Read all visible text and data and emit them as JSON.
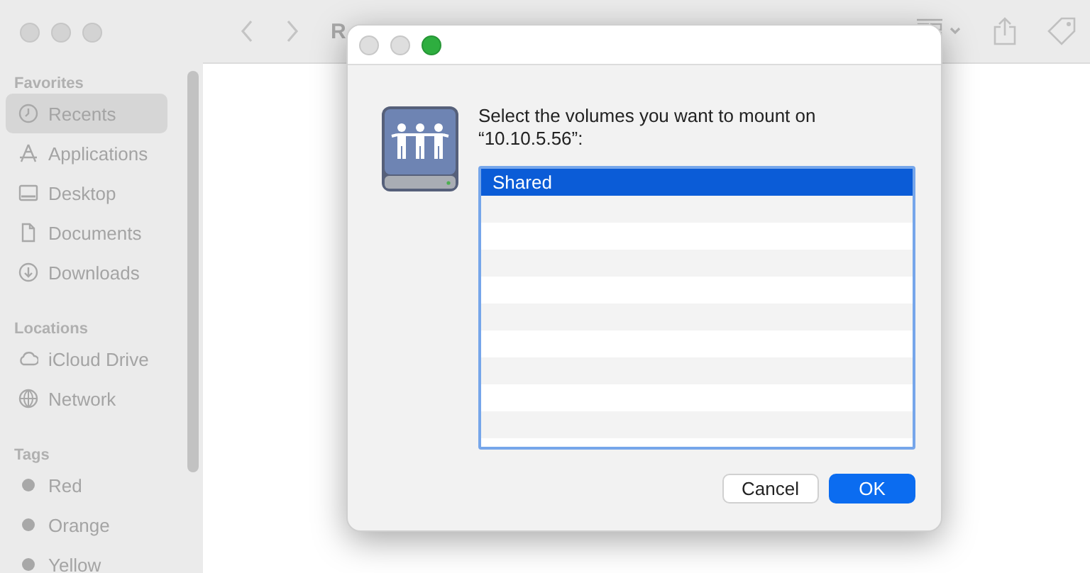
{
  "finder": {
    "title": "R",
    "sidebar": [
      {
        "heading": "Favorites",
        "items": [
          {
            "label": "Recents",
            "kind": "clock",
            "selected": true
          },
          {
            "label": "Applications",
            "kind": "apps",
            "selected": false
          },
          {
            "label": "Desktop",
            "kind": "desktop",
            "selected": false
          },
          {
            "label": "Documents",
            "kind": "document",
            "selected": false
          },
          {
            "label": "Downloads",
            "kind": "download",
            "selected": false
          }
        ]
      },
      {
        "heading": "Locations",
        "items": [
          {
            "label": "iCloud Drive",
            "kind": "cloud",
            "selected": false
          },
          {
            "label": "Network",
            "kind": "globe",
            "selected": false
          }
        ]
      },
      {
        "heading": "Tags",
        "items": [
          {
            "label": "Red",
            "kind": "tag",
            "selected": false
          },
          {
            "label": "Orange",
            "kind": "tag",
            "selected": false
          },
          {
            "label": "Yellow",
            "kind": "tag",
            "selected": false
          }
        ]
      }
    ]
  },
  "dialog": {
    "message": "Select the volumes you want to mount on “10.10.5.56”:",
    "volumes": [
      {
        "name": "Shared",
        "selected": true
      }
    ],
    "buttons": [
      {
        "label": "Cancel",
        "kind": "secondary"
      },
      {
        "label": "OK",
        "kind": "default"
      }
    ]
  }
}
